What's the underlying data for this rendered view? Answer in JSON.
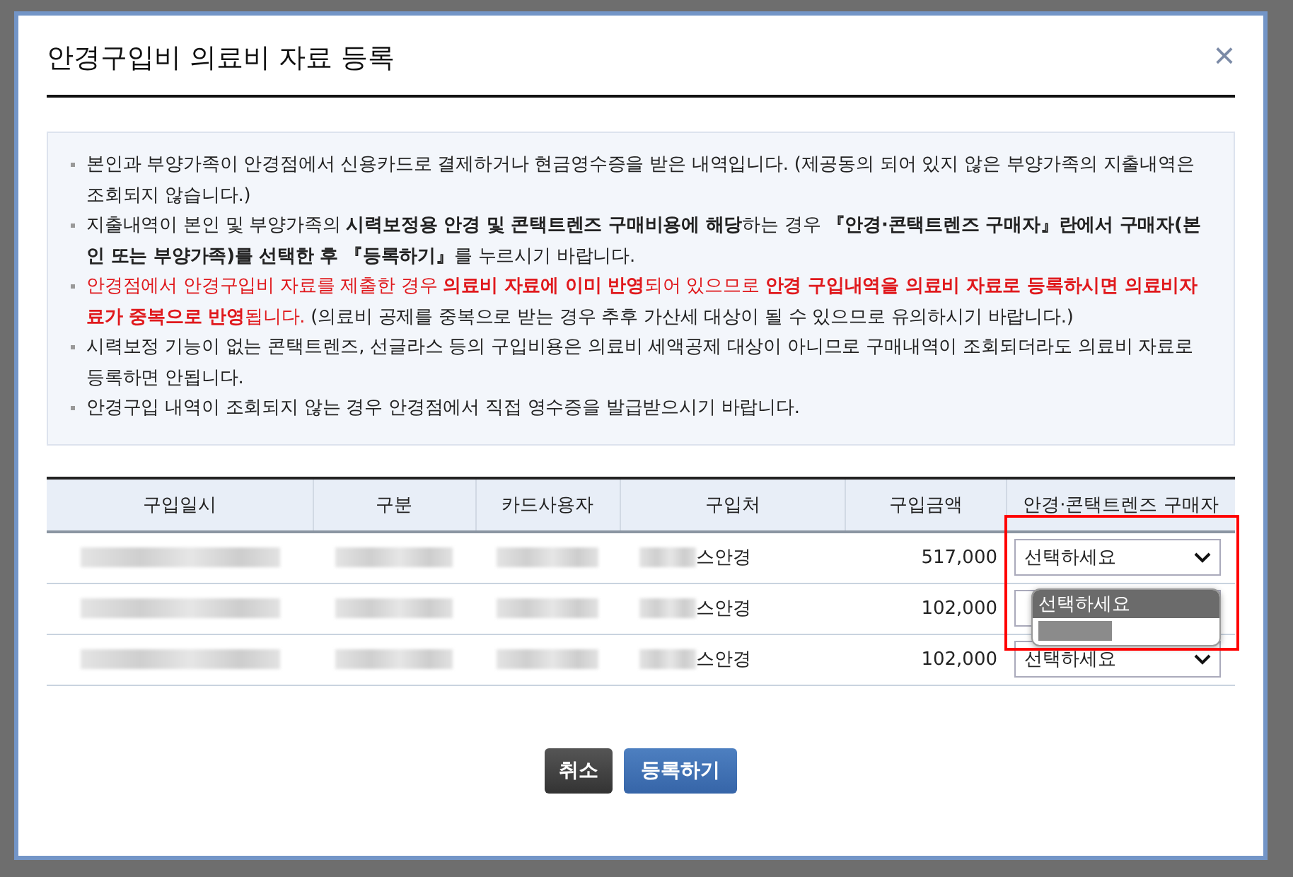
{
  "dialog": {
    "title": "안경구입비 의료비 자료 등록",
    "close": "×"
  },
  "notice": {
    "items": [
      {
        "parts": [
          {
            "text": "본인과 부양가족이 안경점에서 신용카드로 결제하거나 현금영수증을 받은 내역입니다. (제공동의 되어 있지 않은 부양가족의 지출내역은 조회되지 않습니다.)",
            "warning": false
          }
        ]
      },
      {
        "parts": [
          {
            "text": "지출내역이 본인 및 부양가족의 **시력보정용 안경 및 콘택트렌즈 구매비용에 해당**하는 경우 **『안경·콘택트렌즈 구매자』란에서 구매자(본인 또는 부양가족)를 선택한 후 『등록하기』**를 누르시기 바랍니다.",
            "warning": false
          }
        ]
      },
      {
        "parts": [
          {
            "text": "안경점에서 안경구입비 자료를 제출한 경우 **의료비 자료에 이미 반영**되어 있으므로 **안경 구입내역을 의료비 자료로 등록하시면 의료비자료가 중복으로 반영**됩니다.",
            "warning": true
          },
          {
            "text": " (의료비 공제를 중복으로 받는 경우 추후 가산세 대상이 될 수 있으므로 유의하시기 바랍니다.)",
            "warning": false
          }
        ]
      },
      {
        "parts": [
          {
            "text": "시력보정 기능이 없는 콘택트렌즈, 선글라스 등의 구입비용은 의료비 세액공제 대상이 아니므로 구매내역이 조회되더라도 의료비 자료로 등록하면 안됩니다.",
            "warning": false
          }
        ]
      },
      {
        "parts": [
          {
            "text": "안경구입 내역이 조회되지 않는 경우 안경점에서 직접 영수증을 발급받으시기 바랍니다.",
            "warning": false
          }
        ]
      }
    ]
  },
  "table": {
    "columns": [
      "구입일시",
      "구분",
      "카드사용자",
      "구입처",
      "구입금액",
      "안경·콘택트렌즈 구매자"
    ],
    "highlight_buyer_column": true,
    "rows": [
      {
        "cells": [
          {
            "kind": "redacted"
          },
          {
            "kind": "redacted"
          },
          {
            "kind": "redacted"
          },
          {
            "kind": "vendor",
            "text": "스안경"
          },
          {
            "kind": "amount",
            "text": "517,000"
          },
          {
            "kind": "select",
            "value": "선택하세요",
            "open": false
          }
        ]
      },
      {
        "cells": [
          {
            "kind": "redacted"
          },
          {
            "kind": "redacted"
          },
          {
            "kind": "redacted"
          },
          {
            "kind": "vendor",
            "text": "스안경"
          },
          {
            "kind": "amount",
            "text": "102,000"
          },
          {
            "kind": "select",
            "open": true,
            "options": [
              {
                "label": "선택하세요",
                "selected": true
              }
            ]
          }
        ]
      },
      {
        "cells": [
          {
            "kind": "redacted"
          },
          {
            "kind": "redacted"
          },
          {
            "kind": "redacted"
          },
          {
            "kind": "vendor",
            "text": "스안경"
          },
          {
            "kind": "amount",
            "text": "102,000"
          },
          {
            "kind": "select",
            "value": "선택하세요",
            "open": false
          }
        ]
      }
    ]
  },
  "buttons": [
    {
      "label": "취소",
      "kind": "cancel"
    },
    {
      "label": "등록하기",
      "kind": "primary"
    }
  ]
}
